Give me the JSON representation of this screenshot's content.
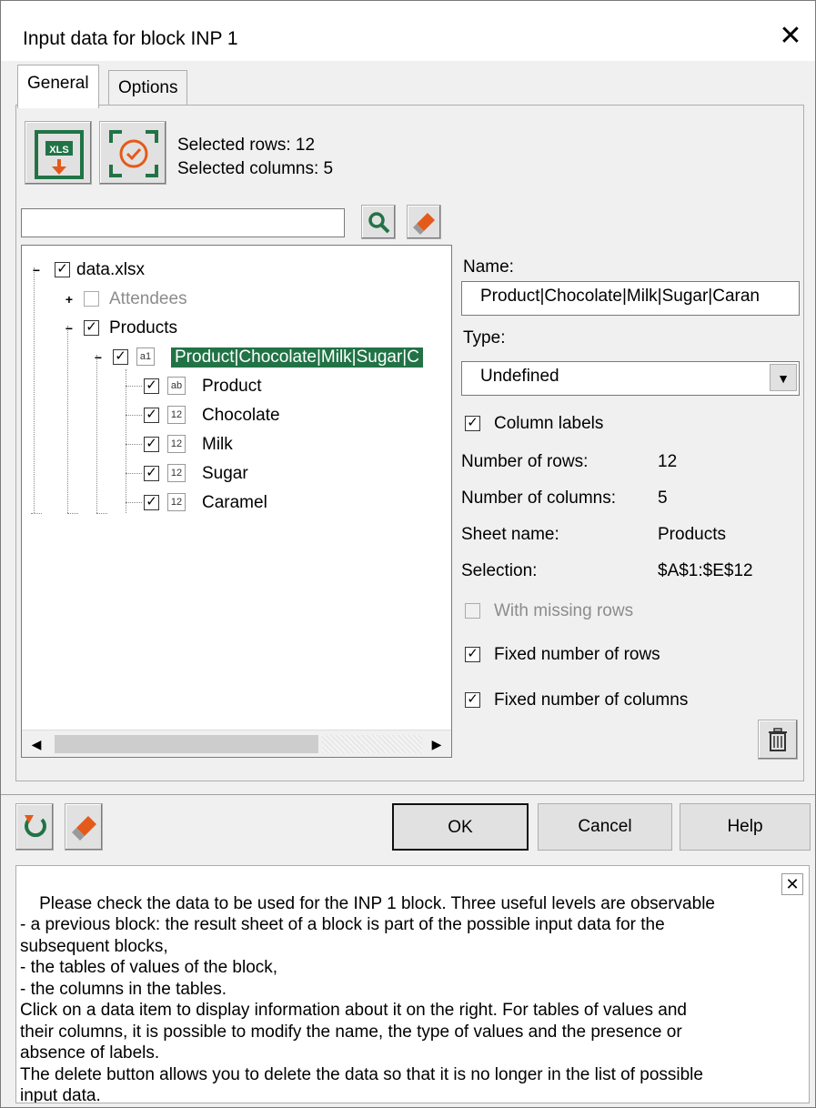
{
  "window": {
    "title": "Input data for block INP 1"
  },
  "tabs": [
    {
      "label": "General"
    },
    {
      "label": "Options"
    }
  ],
  "toolbar": {
    "selected_rows": "Selected rows: 12",
    "selected_columns": "Selected columns: 5",
    "search_value": ""
  },
  "tree": {
    "root": {
      "label": "data.xlsx",
      "checked": true
    },
    "sheets": [
      {
        "label": "Attendees",
        "checked": false,
        "enabled": false
      },
      {
        "label": "Products",
        "checked": true,
        "enabled": true
      }
    ],
    "table": {
      "label": "Product|Chocolate|Milk|Sugar|C",
      "type": "a1",
      "checked": true
    },
    "columns": [
      {
        "label": "Product",
        "type": "ab",
        "checked": true
      },
      {
        "label": "Chocolate",
        "type": "12",
        "checked": true
      },
      {
        "label": "Milk",
        "type": "12",
        "checked": true
      },
      {
        "label": "Sugar",
        "type": "12",
        "checked": true
      },
      {
        "label": "Caramel",
        "type": "12",
        "checked": true
      }
    ]
  },
  "details": {
    "name_label": "Name:",
    "name_value": "Product|Chocolate|Milk|Sugar|Caran",
    "type_label": "Type:",
    "type_value": "Undefined",
    "column_labels": "Column labels",
    "rows_label": "Number of rows:",
    "rows_value": "12",
    "cols_label": "Number of columns:",
    "cols_value": "5",
    "sheet_label": "Sheet name:",
    "sheet_value": "Products",
    "selection_label": "Selection:",
    "selection_value": "$A$1:$E$12",
    "missing_rows": "With missing rows",
    "fixed_rows": "Fixed number of rows",
    "fixed_columns": "Fixed number of columns"
  },
  "buttons": {
    "ok": "OK",
    "cancel": "Cancel",
    "help": "Help"
  },
  "help_text": "Please check the data to be used for the INP 1 block. Three useful levels are observable\n- a previous block: the result sheet of a block is part of the possible input data for the\nsubsequent blocks,\n- the tables of values of the block,\n- the columns in the tables.\nClick on a data item to display information about it on the right. For tables of values and\ntheir columns, it is possible to modify the name, the type of values and the presence or\nabsence of labels.\nThe delete button allows you to delete the data so that it is no longer in the list of possible\ninput data."
}
